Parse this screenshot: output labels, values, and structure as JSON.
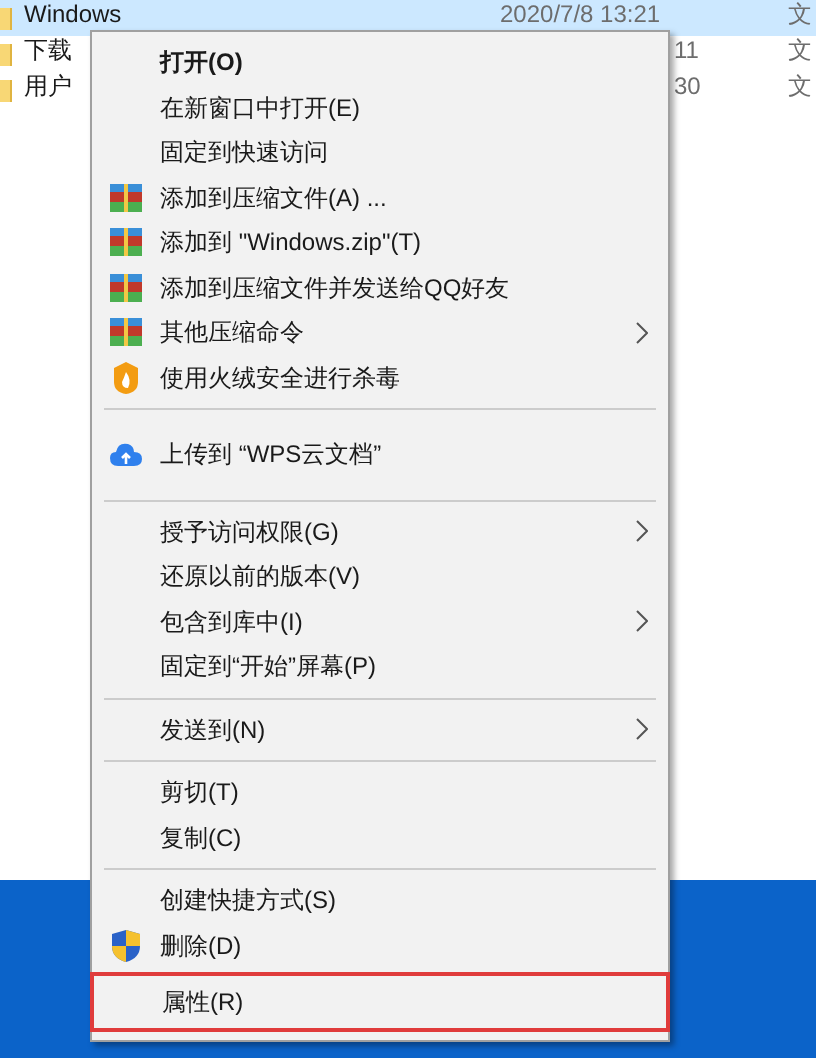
{
  "files": [
    {
      "name": "Windows",
      "date": "2020/7/8 13:21",
      "type": "文",
      "selected": true
    },
    {
      "name": "下载",
      "date": "11",
      "type": "文",
      "selected": false
    },
    {
      "name": "用户",
      "date": "30",
      "type": "文",
      "selected": false
    }
  ],
  "context_menu": {
    "items": [
      {
        "kind": "plain",
        "label": "打开(O)",
        "bold": true,
        "submenu": false
      },
      {
        "kind": "plain",
        "label": "在新窗口中打开(E)",
        "submenu": false
      },
      {
        "kind": "plain",
        "label": "固定到快速访问",
        "submenu": false
      },
      {
        "kind": "archive",
        "label": "添加到压缩文件(A) ...",
        "submenu": false
      },
      {
        "kind": "archive",
        "label": "添加到 \"Windows.zip\"(T)",
        "submenu": false
      },
      {
        "kind": "archive",
        "label": "添加到压缩文件并发送给QQ好友",
        "submenu": false
      },
      {
        "kind": "archive",
        "label": "其他压缩命令",
        "submenu": true
      },
      {
        "kind": "flame",
        "label": "使用火绒安全进行杀毒",
        "submenu": false
      },
      {
        "kind": "separator"
      },
      {
        "kind": "cloud",
        "label": "上传到 “WPS云文档”",
        "submenu": false
      },
      {
        "kind": "separator"
      },
      {
        "kind": "plain",
        "label": "授予访问权限(G)",
        "submenu": true
      },
      {
        "kind": "plain",
        "label": "还原以前的版本(V)",
        "submenu": false
      },
      {
        "kind": "plain",
        "label": "包含到库中(I)",
        "submenu": true
      },
      {
        "kind": "plain",
        "label": "固定到“开始”屏幕(P)",
        "submenu": false
      },
      {
        "kind": "separator"
      },
      {
        "kind": "plain",
        "label": "发送到(N)",
        "submenu": true
      },
      {
        "kind": "separator"
      },
      {
        "kind": "plain",
        "label": "剪切(T)",
        "submenu": false
      },
      {
        "kind": "plain",
        "label": "复制(C)",
        "submenu": false
      },
      {
        "kind": "separator"
      },
      {
        "kind": "plain",
        "label": "创建快捷方式(S)",
        "submenu": false
      },
      {
        "kind": "shield",
        "label": "删除(D)",
        "submenu": false
      },
      {
        "kind": "plain",
        "label": "属性(R)",
        "submenu": false,
        "highlighted": true
      }
    ]
  }
}
